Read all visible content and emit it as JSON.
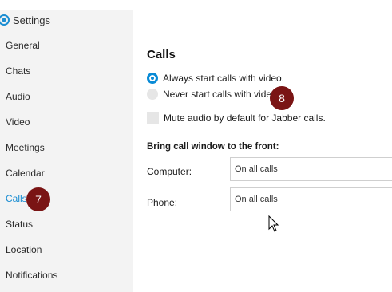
{
  "window": {
    "title": "Settings"
  },
  "sidebar": {
    "items": [
      {
        "label": "General"
      },
      {
        "label": "Chats"
      },
      {
        "label": "Audio"
      },
      {
        "label": "Video"
      },
      {
        "label": "Meetings"
      },
      {
        "label": "Calendar"
      },
      {
        "label": "Calls"
      },
      {
        "label": "Status"
      },
      {
        "label": "Location"
      },
      {
        "label": "Notifications"
      }
    ],
    "active": "Calls"
  },
  "calls": {
    "title": "Calls",
    "option_always_video": "Always start calls with video.",
    "option_never_video": "Never start calls with video.",
    "option_mute_audio": "Mute audio by default for Jabber calls.",
    "bring_front_title": "Bring call window to the front:",
    "computer_label": "Computer:",
    "computer_value": "On all calls",
    "phone_label": "Phone:",
    "phone_value": "On all calls"
  },
  "badges": {
    "sidebar_badge": "7",
    "option_badge": "8"
  },
  "colors": {
    "accent": "#1a8dd2",
    "badge": "#7a1414"
  }
}
